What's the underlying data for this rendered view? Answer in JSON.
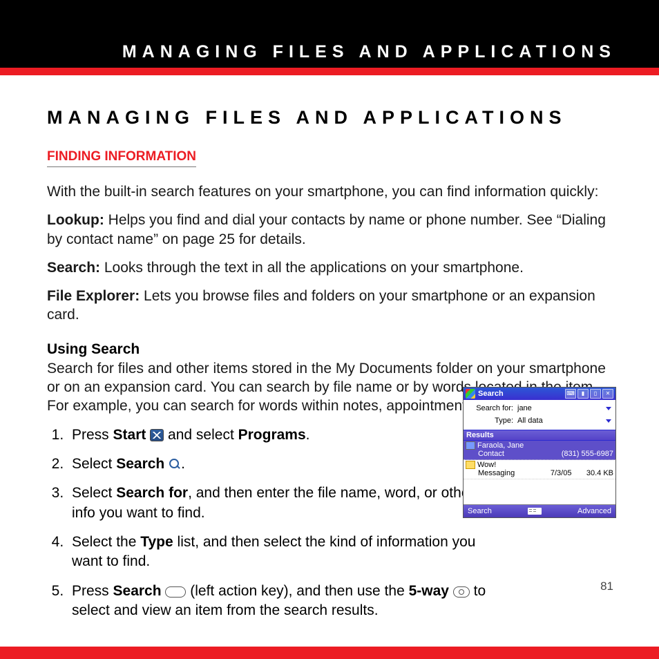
{
  "header": {
    "running_title": "MANAGING FILES AND APPLICATIONS"
  },
  "title": "MANAGING FILES AND APPLICATIONS",
  "section": "FINDING INFORMATION",
  "intro": "With the built-in search features on your smartphone, you can find information quickly:",
  "defs": {
    "lookup_label": "Lookup:",
    "lookup_text": " Helps you find and dial your contacts by name or phone number. See “Dialing by contact name” on page 25 for details.",
    "search_label": "Search:",
    "search_text": " Looks through the text in all the applications on your smartphone.",
    "file_label": "File Explorer:",
    "file_text": " Lets you browse files and folders on your smartphone or an expansion card."
  },
  "using_search": {
    "heading": "Using Search",
    "intro": "Search for files and other items stored in the My Documents folder on your smartphone or on an expansion card. You can search by file name or by words located in the item. For example, you can search for words within notes, appointments, contacts, and tasks."
  },
  "steps": {
    "1_a": "Press ",
    "1_b": "Start",
    "1_c": " and select ",
    "1_d": "Programs",
    "1_e": ".",
    "2_a": "Select ",
    "2_b": "Search",
    "2_c": ".",
    "3_a": "Select ",
    "3_b": "Search for",
    "3_c": ", and then enter the file name, word, or other info you want to find.",
    "4_a": "Select the ",
    "4_b": "Type",
    "4_c": " list, and then select the kind of information you want to find.",
    "5_a": "Press ",
    "5_b": "Search",
    "5_c": " (left action key), and then use the ",
    "5_d": "5-way",
    "5_e": " to select and view an item from the search results."
  },
  "figure": {
    "title": "Search",
    "form": {
      "searchfor_label": "Search for:",
      "searchfor_value": "jane",
      "type_label": "Type:",
      "type_value": "All data"
    },
    "results_header": "Results",
    "items": [
      {
        "name": "Faraola, Jane",
        "kind": "Contact",
        "meta1": "(831) 555-6987",
        "meta2": ""
      },
      {
        "name": "Wow!",
        "kind": "Messaging",
        "meta1": "7/3/05",
        "meta2": "30.4 KB"
      }
    ],
    "softkeys": {
      "left": "Search",
      "right": "Advanced"
    }
  },
  "page_number": "81"
}
